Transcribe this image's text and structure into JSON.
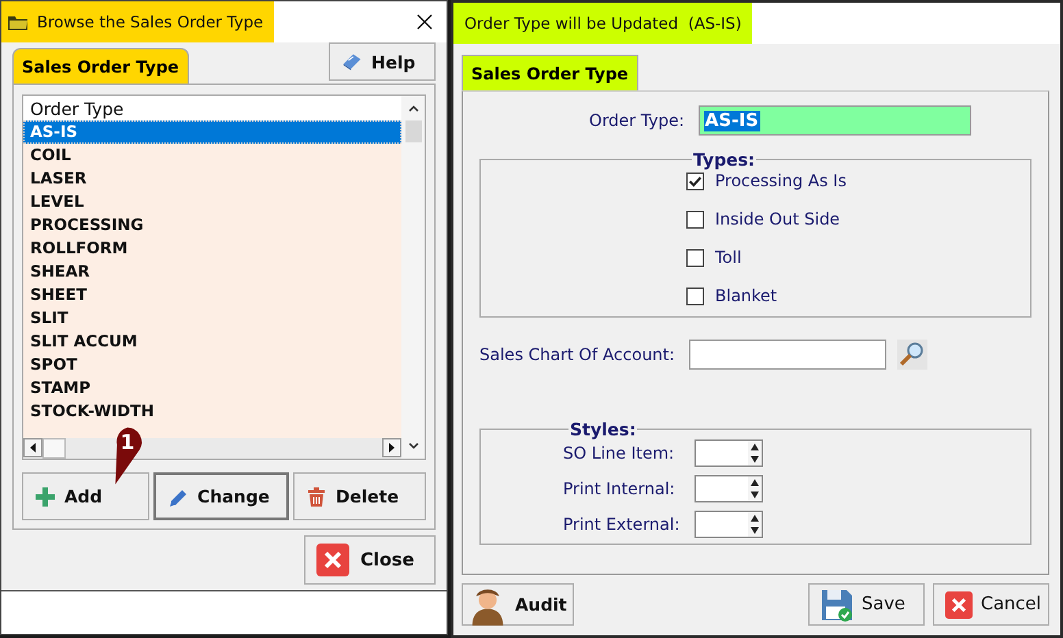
{
  "left_window": {
    "title": "Browse the Sales Order Type",
    "tabs": [
      {
        "label": "Sales Order Type",
        "selected": true
      }
    ],
    "help_button": "Help",
    "list": {
      "column": "Order Type",
      "rows": [
        {
          "label": "AS-IS",
          "selected": true
        },
        {
          "label": "COIL",
          "selected": false
        },
        {
          "label": "LASER",
          "selected": false
        },
        {
          "label": "LEVEL",
          "selected": false
        },
        {
          "label": "PROCESSING",
          "selected": false
        },
        {
          "label": "ROLLFORM",
          "selected": false
        },
        {
          "label": "SHEAR",
          "selected": false
        },
        {
          "label": "SHEET",
          "selected": false
        },
        {
          "label": "SLIT",
          "selected": false
        },
        {
          "label": "SLIT ACCUM",
          "selected": false
        },
        {
          "label": "SPOT",
          "selected": false
        },
        {
          "label": "STAMP",
          "selected": false
        },
        {
          "label": "STOCK-WIDTH",
          "selected": false
        }
      ]
    },
    "buttons": [
      {
        "label": "Add",
        "kind": "add"
      },
      {
        "label": "Change",
        "kind": "change"
      },
      {
        "label": "Delete",
        "kind": "delete"
      }
    ],
    "close_button": "Close",
    "callout": "1"
  },
  "right_window": {
    "title": "Order Type will be Updated  (AS-IS)",
    "tabs": [
      {
        "label": "Sales Order Type",
        "selected": true
      }
    ],
    "order_type": {
      "label": "Order Type:",
      "value": "AS-IS"
    },
    "types": {
      "title": "Types:",
      "options": [
        {
          "label": "Processing As Is",
          "checked": true
        },
        {
          "label": "Inside Out Side",
          "checked": false
        },
        {
          "label": "Toll",
          "checked": false
        },
        {
          "label": "Blanket",
          "checked": false
        }
      ]
    },
    "sales_chart": {
      "label": "Sales Chart Of Account:"
    },
    "styles": {
      "title": "Styles:",
      "fields": [
        {
          "label": "SO Line Item:"
        },
        {
          "label": "Print Internal:"
        },
        {
          "label": "Print External:"
        }
      ]
    },
    "buttons": [
      {
        "label": "Audit",
        "kind": "audit"
      },
      {
        "label": "Save",
        "kind": "save"
      },
      {
        "label": "Cancel",
        "kind": "cancel"
      }
    ]
  }
}
